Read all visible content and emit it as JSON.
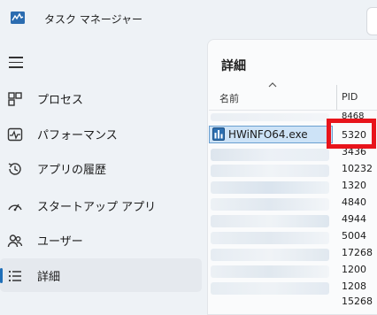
{
  "app": {
    "title": "タスク マネージャー"
  },
  "nav": {
    "items": [
      {
        "label": "プロセス",
        "icon": "processes-icon",
        "active": false
      },
      {
        "label": "パフォーマンス",
        "icon": "performance-icon",
        "active": false
      },
      {
        "label": "アプリの履歴",
        "icon": "app-history-icon",
        "active": false
      },
      {
        "label": "スタートアップ アプリ",
        "icon": "startup-apps-icon",
        "active": false
      },
      {
        "label": "ユーザー",
        "icon": "users-icon",
        "active": false
      },
      {
        "label": "詳細",
        "icon": "details-icon",
        "active": true
      }
    ]
  },
  "details": {
    "title": "詳細",
    "columns": {
      "name": "名前",
      "pid": "PID"
    },
    "selected_process": {
      "name": "HWiNFO64.exe",
      "pid": "5320"
    },
    "pids": [
      "8468",
      "5320",
      "3436",
      "10232",
      "1320",
      "4840",
      "4944",
      "5004",
      "17268",
      "1200",
      "1208",
      "15268"
    ]
  },
  "colors": {
    "accent": "#1f6fb8",
    "highlight_box": "#e8141b",
    "selection": "#cde3f7"
  }
}
